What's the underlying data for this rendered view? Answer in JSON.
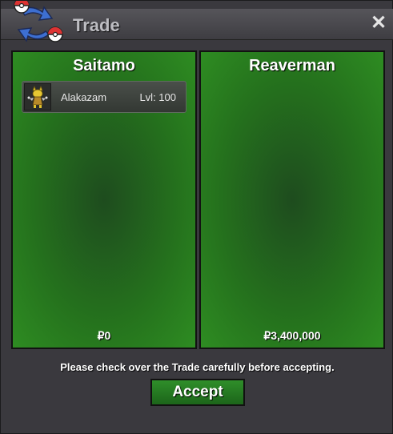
{
  "window": {
    "title": "Trade",
    "close_icon": "close-icon",
    "logo_icon": "trade-arrows-pokeball-icon"
  },
  "left_panel": {
    "name": "Saitamo",
    "items": [
      {
        "name": "Alakazam",
        "level": "Lvl: 100",
        "sprite_icon": "alakazam-sprite-icon"
      }
    ],
    "money": "₽0"
  },
  "right_panel": {
    "name": "Reaverman",
    "items": [],
    "money": "₽3,400,000"
  },
  "notice": "Please check over the Trade carefully before accepting.",
  "accept_label": "Accept",
  "colors": {
    "panel_green": "#25731d",
    "window_bg": "#3a393e",
    "accent_red": "#d33"
  }
}
